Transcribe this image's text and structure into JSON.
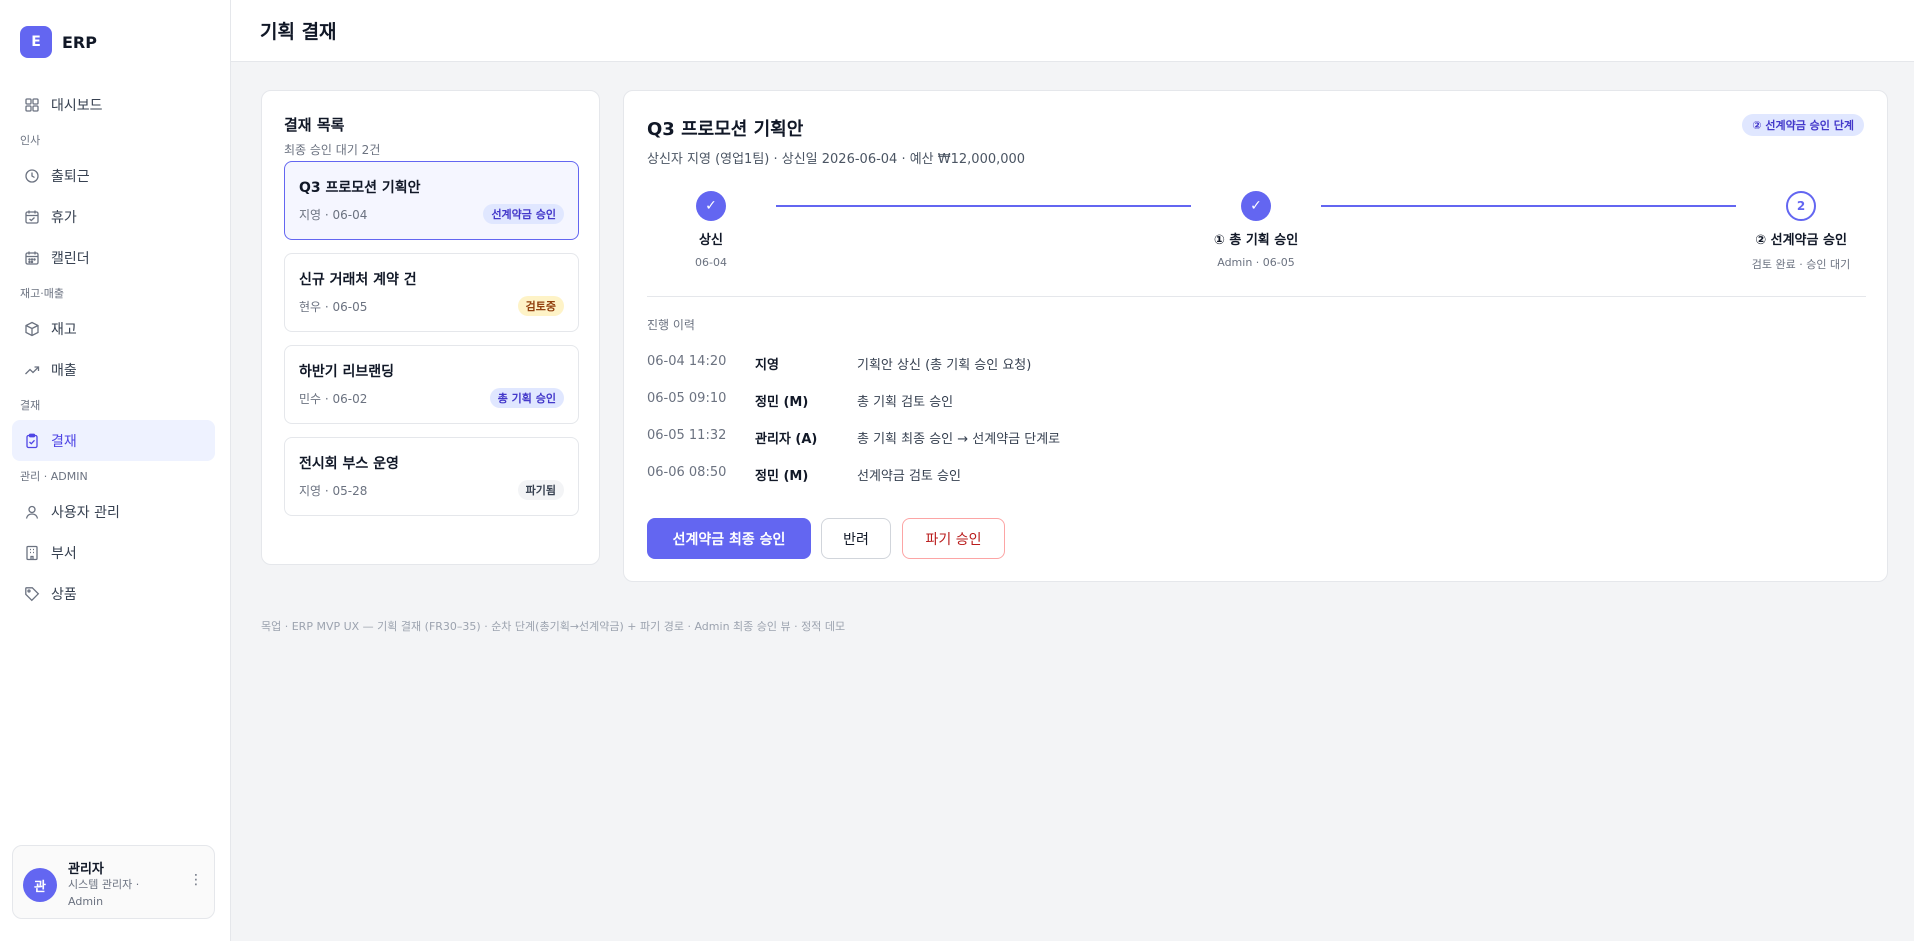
{
  "brand": {
    "logo": "E",
    "name": "ERP"
  },
  "sidebar": {
    "items": [
      {
        "type": "item",
        "label": "대시보드",
        "icon": "grid-icon"
      },
      {
        "type": "section",
        "label": "인사"
      },
      {
        "type": "item",
        "label": "출퇴근",
        "icon": "clock-icon"
      },
      {
        "type": "item",
        "label": "휴가",
        "icon": "calendar-check-icon"
      },
      {
        "type": "item",
        "label": "캘린더",
        "icon": "calendar-icon"
      },
      {
        "type": "section",
        "label": "재고·매출"
      },
      {
        "type": "item",
        "label": "재고",
        "icon": "box-icon"
      },
      {
        "type": "item",
        "label": "매출",
        "icon": "trend-icon"
      },
      {
        "type": "section",
        "label": "결재"
      },
      {
        "type": "item",
        "label": "결재",
        "icon": "clipboard-icon",
        "active": true
      },
      {
        "type": "section",
        "label": "관리 · ADMIN"
      },
      {
        "type": "item",
        "label": "사용자 관리",
        "icon": "user-icon"
      },
      {
        "type": "item",
        "label": "부서",
        "icon": "building-icon"
      },
      {
        "type": "item",
        "label": "상품",
        "icon": "tag-icon"
      }
    ]
  },
  "user": {
    "avatar": "관",
    "name": "관리자",
    "role": "시스템 관리자 · Admin",
    "menu": "⋮"
  },
  "header": {
    "title": "기획 결재"
  },
  "list": {
    "title": "결재 목록",
    "subtitle": "최종 승인 대기 2건",
    "docs": [
      {
        "title": "Q3 프로모션 기획안",
        "meta": "지영 · 06-04",
        "badge": "선계약금 승인",
        "badge_color": "blue",
        "selected": true
      },
      {
        "title": "신규 거래처 계약 건",
        "meta": "현우 · 06-05",
        "badge": "검토중",
        "badge_color": "yellow"
      },
      {
        "title": "하반기 리브랜딩",
        "meta": "민수 · 06-02",
        "badge": "총 기획 승인",
        "badge_color": "blue"
      },
      {
        "title": "전시회 부스 운영",
        "meta": "지영 · 05-28",
        "badge": "파기됨",
        "badge_color": "gray"
      }
    ]
  },
  "detail": {
    "title": "Q3 프로모션 기획안",
    "meta": "상신자 지영 (영업1팀) · 상신일 2026-06-04 · 예산 ₩12,000,000",
    "stage_badge": "② 선계약금 승인 단계",
    "steps": [
      {
        "label": "상신",
        "sub": "06-04",
        "state": "done",
        "mark": "✓"
      },
      {
        "label": "① 총 기획 승인",
        "sub": "Admin · 06-05",
        "state": "done",
        "mark": "✓"
      },
      {
        "label": "② 선계약금 승인",
        "sub": "검토 완료 · 승인 대기",
        "state": "current",
        "mark": "2"
      }
    ],
    "history_title": "진행 이력",
    "history": [
      {
        "time": "06-04 14:20",
        "who": "지영",
        "action": "기획안 상신 (총 기획 승인 요청)"
      },
      {
        "time": "06-05 09:10",
        "who": "정민 (M)",
        "action": "총 기획 검토 승인"
      },
      {
        "time": "06-05 11:32",
        "who": "관리자 (A)",
        "action": "총 기획 최종 승인 → 선계약금 단계로"
      },
      {
        "time": "06-06 08:50",
        "who": "정민 (M)",
        "action": "선계약금 검토 승인"
      }
    ],
    "buttons": {
      "approve": "선계약금 최종 승인",
      "reject": "반려",
      "discard": "파기 승인"
    }
  },
  "footer_note": "목업 · ERP MVP UX — 기획 결재 (FR30–35) · 순차 단계(총기획→선계약금) + 파기 경로 · Admin 최종 승인 뷰 · 정적 데모",
  "colors": {
    "accent": "#6366f1",
    "danger": "#b91c1c"
  }
}
